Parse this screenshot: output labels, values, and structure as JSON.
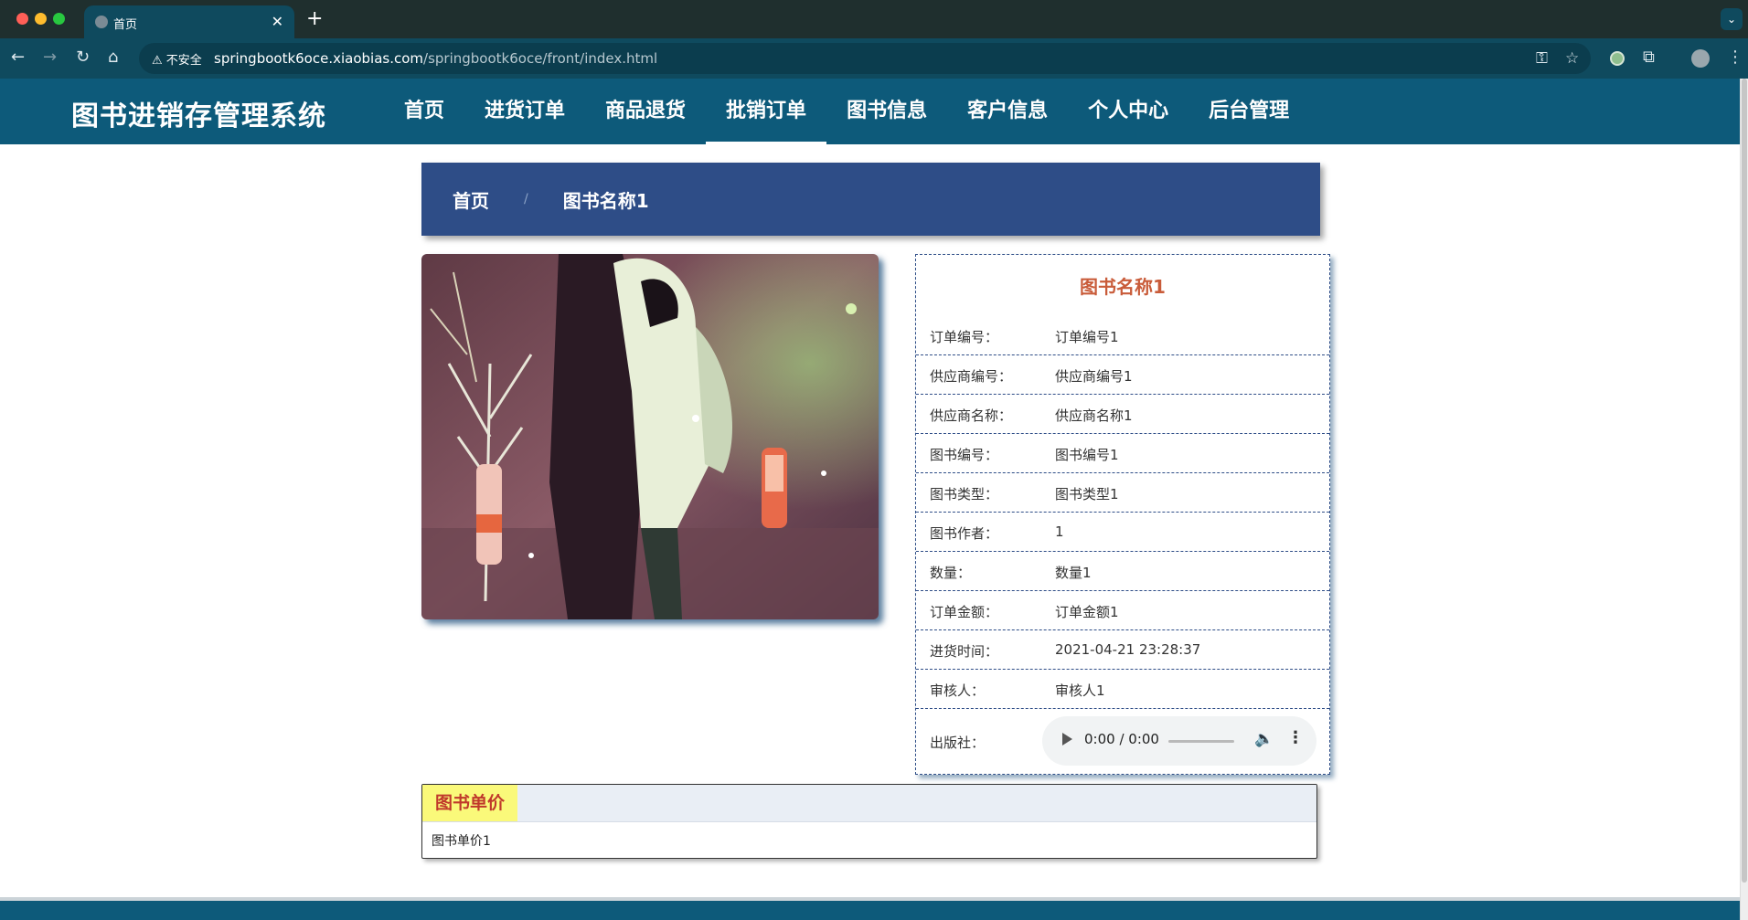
{
  "browser": {
    "tab_title": "首页",
    "security_label": "不安全",
    "url_host": "springbootk6oce.xiaobias.com",
    "url_path": "/springbootk6oce/front/index.html"
  },
  "site": {
    "logo": "图书进销存管理系统",
    "nav": [
      {
        "label": "首页"
      },
      {
        "label": "进货订单"
      },
      {
        "label": "商品退货"
      },
      {
        "label": "批销订单"
      },
      {
        "label": "图书信息"
      },
      {
        "label": "客户信息"
      },
      {
        "label": "个人中心"
      },
      {
        "label": "后台管理"
      }
    ],
    "active_nav": "批销订单"
  },
  "breadcrumb": {
    "home": "首页",
    "separator": "/",
    "current": "图书名称1"
  },
  "detail": {
    "title": "图书名称1",
    "fields": [
      {
        "label": "订单编号：",
        "value": "订单编号1"
      },
      {
        "label": "供应商编号：",
        "value": "供应商编号1"
      },
      {
        "label": "供应商名称：",
        "value": "供应商名称1"
      },
      {
        "label": "图书编号：",
        "value": "图书编号1"
      },
      {
        "label": "图书类型：",
        "value": "图书类型1"
      },
      {
        "label": "图书作者：",
        "value": "1"
      },
      {
        "label": "数量：",
        "value": "数量1"
      },
      {
        "label": "订单金额：",
        "value": "订单金额1"
      },
      {
        "label": "进货时间：",
        "value": "2021-04-21 23:28:37"
      },
      {
        "label": "审核人：",
        "value": "审核人1"
      }
    ],
    "publisher_label": "出版社：",
    "audio_time": "0:00 / 0:00"
  },
  "price_panel": {
    "tab_label": "图书单价",
    "content": "图书单价1"
  },
  "colors": {
    "header_bg": "#0d5a7a",
    "breadcrumb_bg": "#2e4d87",
    "title_accent": "#c95c3a",
    "tab_highlight": "#faf97a"
  }
}
